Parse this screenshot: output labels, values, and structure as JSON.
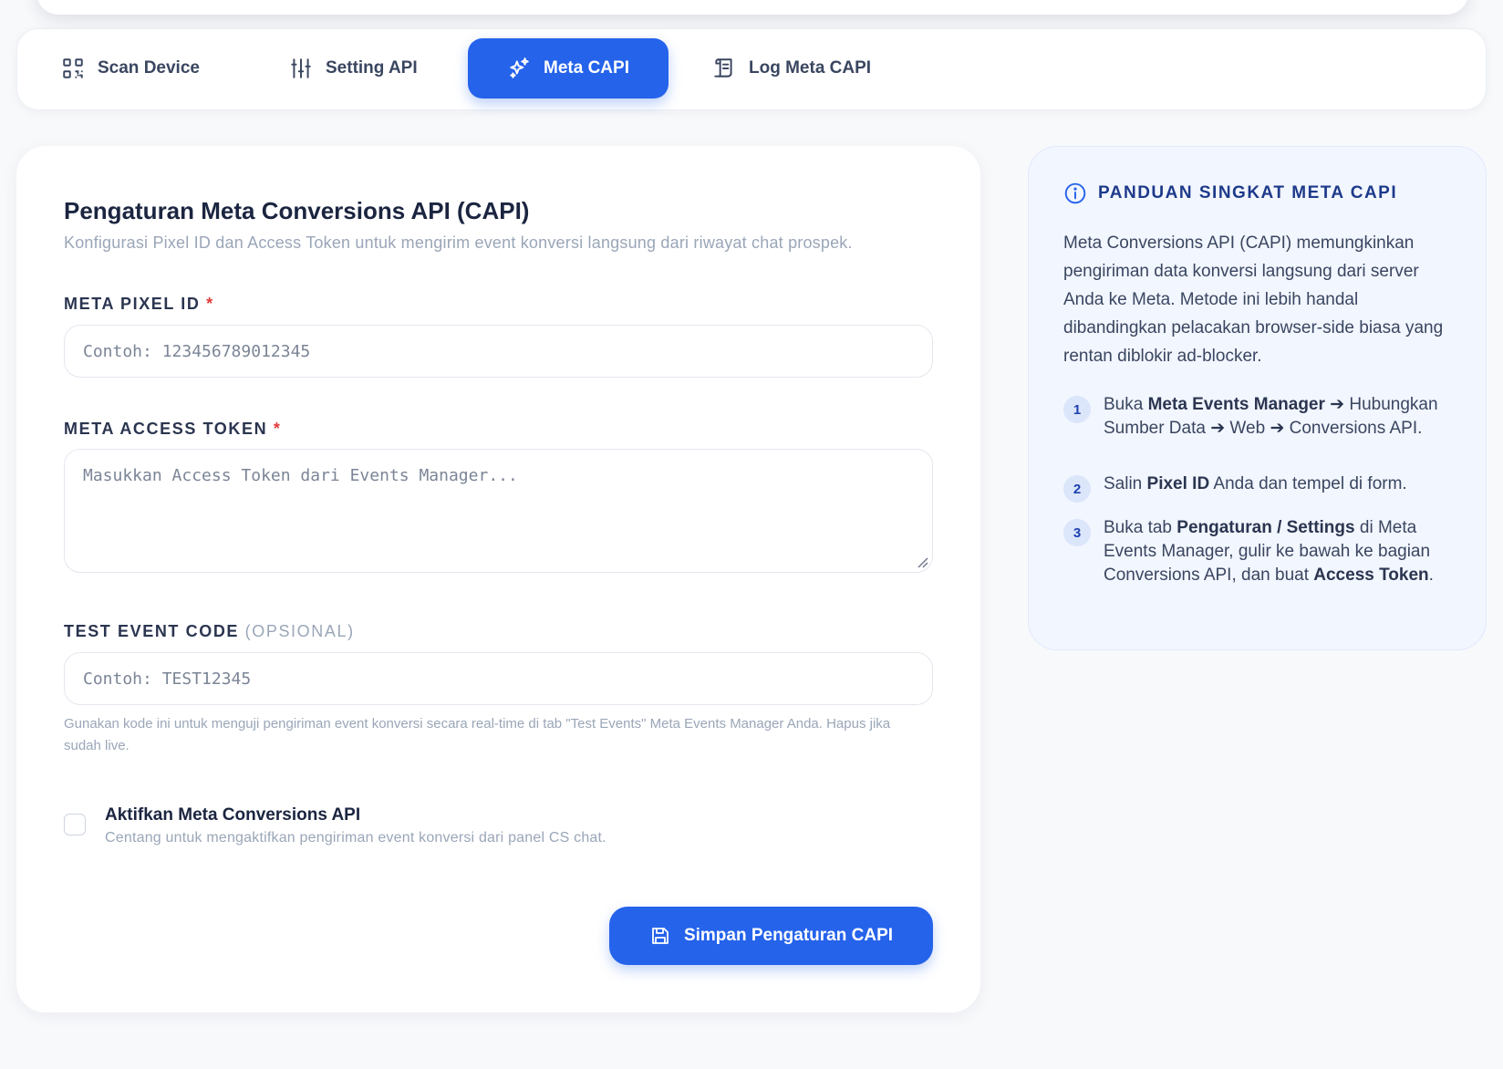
{
  "tabs": [
    {
      "label": "Scan Device",
      "icon": "qr-code-icon",
      "active": false
    },
    {
      "label": "Setting API",
      "icon": "sliders-icon",
      "active": false
    },
    {
      "label": "Meta CAPI",
      "icon": "sparkles-icon",
      "active": true
    },
    {
      "label": "Log Meta CAPI",
      "icon": "scroll-icon",
      "active": false
    }
  ],
  "form": {
    "title": "Pengaturan Meta Conversions API (CAPI)",
    "subtitle": "Konfigurasi Pixel ID dan Access Token untuk mengirim event konversi langsung dari riwayat chat prospek.",
    "pixel": {
      "label": "META PIXEL ID",
      "required_mark": "*",
      "value": "",
      "placeholder": "Contoh: 123456789012345"
    },
    "token": {
      "label": "META ACCESS TOKEN",
      "required_mark": "*",
      "value": "",
      "placeholder": "Masukkan Access Token dari Events Manager..."
    },
    "test_code": {
      "label": "TEST EVENT CODE",
      "optional": "(OPSIONAL)",
      "value": "",
      "placeholder": "Contoh: TEST12345",
      "help": "Gunakan kode ini untuk menguji pengiriman event konversi secara real-time di tab \"Test Events\" Meta Events Manager Anda. Hapus jika sudah live."
    },
    "enable": {
      "checked": false,
      "title": "Aktifkan Meta Conversions API",
      "subtitle": "Centang untuk mengaktifkan pengiriman event konversi dari panel CS chat."
    },
    "save_label": "Simpan Pengaturan CAPI"
  },
  "guide": {
    "title": "PANDUAN SINGKAT META CAPI",
    "intro": "Meta Conversions API (CAPI) memungkinkan pengiriman data konversi langsung dari server Anda ke Meta. Metode ini lebih handal dibandingkan pelacakan browser-side biasa yang rentan diblokir ad-blocker.",
    "steps": [
      {
        "num": "1",
        "t1": "Buka ",
        "b1": "Meta Events Manager ➔",
        "t2": " Hubungkan Sumber Data ",
        "b2": "➔",
        "t3": " Web ",
        "b3": "➔",
        "t4": " Conversions API."
      },
      {
        "num": "2",
        "t1": "Salin ",
        "b1": "Pixel ID",
        "t2": " Anda dan tempel di form."
      },
      {
        "num": "3",
        "t1": "Buka tab ",
        "b1": "Pengaturan / Settings",
        "t2": " di Meta Events Manager, gulir ke bawah ke bagian Conversions API, dan buat ",
        "b2": "Access Token",
        "t3": "."
      }
    ]
  },
  "colors": {
    "accent": "#2563eb",
    "required": "#e23b3b",
    "guide_bg": "#f2f6ff"
  }
}
